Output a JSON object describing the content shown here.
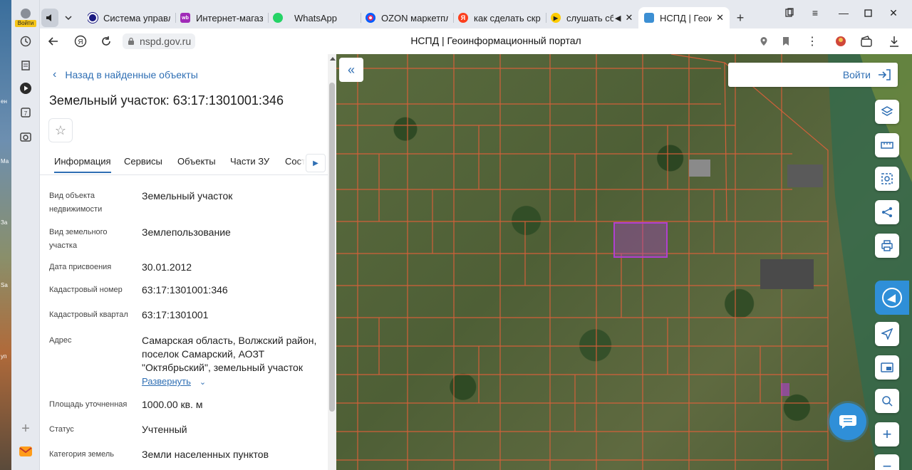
{
  "desktop": {
    "labels": [
      "ен",
      "Ма",
      "За",
      "Sa",
      "уп"
    ]
  },
  "browser": {
    "profile_label": "Войти",
    "tabs": [
      {
        "title": "Система управле",
        "fav_color": "#1a1a80",
        "fav_glyph": ""
      },
      {
        "title": "Интернет-магази",
        "fav_color": "#a02bb8",
        "fav_glyph": "wb"
      },
      {
        "title": "WhatsApp",
        "fav_color": "#25d366",
        "fav_glyph": ""
      },
      {
        "title": "OZON маркетплей",
        "fav_color": "#005bff",
        "fav_glyph": ""
      },
      {
        "title": "как сделать скрин",
        "fav_color": "#fc3f1d",
        "fav_glyph": "Я"
      },
      {
        "title": "слушать сбо",
        "fav_color": "#ffcc00",
        "fav_glyph": "▶"
      },
      {
        "title": "НСПД | Геоинф",
        "fav_color": "#3c8fd3",
        "fav_glyph": ""
      }
    ],
    "url": "nspd.gov.ru",
    "page_title": "НСПД | Геоинформационный портал"
  },
  "panel": {
    "back_label": "Назад в найденные объекты",
    "title": "Земельный участок: 63:17:1301001:346",
    "tabs": [
      "Информация",
      "Сервисы",
      "Объекты",
      "Части ЗУ",
      "Соста"
    ],
    "rows": [
      {
        "key": "Вид объекта недвижимости",
        "value": "Земельный участок"
      },
      {
        "key": "Вид земельного участка",
        "value": "Землепользование"
      },
      {
        "key": "Дата присвоения",
        "value": "30.01.2012"
      },
      {
        "key": "Кадастровый номер",
        "value": "63:17:1301001:346"
      },
      {
        "key": "Кадастровый квартал",
        "value": "63:17:1301001"
      },
      {
        "key": "Адрес",
        "value": "Самарская область, Волжский район, поселок Самарский, АОЗТ \"Октябрьский\", земельный участок"
      },
      {
        "key": "Площадь уточненная",
        "value": "1000.00 кв. м"
      },
      {
        "key": "Статус",
        "value": "Учтенный"
      },
      {
        "key": "Категория земель",
        "value": "Земли населенных пунктов"
      }
    ],
    "expand_label": "Развернуть"
  },
  "map": {
    "login_label": "Войти",
    "accent": "#2f6fb4",
    "parcel_color": "#e0603a",
    "selected_color": "#b040d0"
  }
}
